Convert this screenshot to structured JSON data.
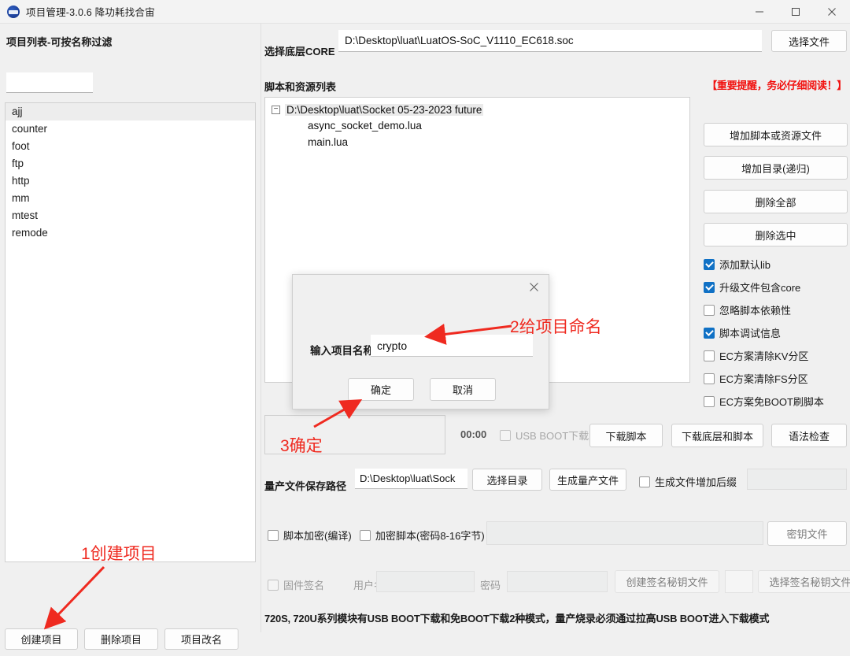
{
  "window": {
    "title": "项目管理-3.0.6 降功耗找合宙",
    "icon": "app-logo-icon",
    "controls": {
      "minimize": "minimize-icon",
      "maximize": "maximize-icon",
      "close": "close-icon"
    }
  },
  "left_panel": {
    "list_label": "项目列表-可按名称过滤",
    "filter_value": "",
    "filter_placeholder": "",
    "items": [
      {
        "label": "ajj",
        "selected": true
      },
      {
        "label": "counter",
        "selected": false
      },
      {
        "label": "foot",
        "selected": false
      },
      {
        "label": "ftp",
        "selected": false
      },
      {
        "label": "http",
        "selected": false
      },
      {
        "label": "mm",
        "selected": false
      },
      {
        "label": "mtest",
        "selected": false
      },
      {
        "label": "remode",
        "selected": false
      }
    ],
    "buttons": {
      "create": "创建项目",
      "delete": "删除项目",
      "rename": "项目改名"
    }
  },
  "main": {
    "core_label": "选择底层CORE",
    "core_path": "D:\\Desktop\\luat\\LuatOS-SoC_V1110_EC618.soc",
    "choose_file_button": "选择文件",
    "script_label": "脚本和资源列表",
    "warning": "【重要提醒，务必仔细阅读！】",
    "tree": {
      "toggle": "−",
      "root": "D:\\Desktop\\luat\\Socket 05-23-2023 future",
      "children": [
        "async_socket_demo.lua",
        "main.lua"
      ]
    },
    "right_buttons": [
      "增加脚本或资源文件",
      "增加目录(递归)",
      "删除全部",
      "删除选中"
    ],
    "checkboxes": [
      {
        "label": "添加默认lib",
        "checked": true
      },
      {
        "label": "升级文件包含core",
        "checked": true
      },
      {
        "label": "忽略脚本依赖性",
        "checked": false
      },
      {
        "label": "脚本调试信息",
        "checked": true
      },
      {
        "label": "EC方案清除KV分区",
        "checked": false
      },
      {
        "label": "EC方案清除FS分区",
        "checked": false
      },
      {
        "label": "EC方案免BOOT刷脚本",
        "checked": false
      }
    ],
    "download_row": {
      "timer": "00:00",
      "usb_boot_label": "USB BOOT下载",
      "usb_boot_checked": false,
      "download_script": "下载脚本",
      "download_core_and_script": "下载底层和脚本",
      "syntax_check": "语法检查"
    },
    "mass_production": {
      "label": "量产文件保存路径",
      "path": "D:\\Desktop\\luat\\Sock",
      "choose_dir": "选择目录",
      "generate": "生成量产文件",
      "suffix_label": "生成文件增加后缀",
      "suffix_checked": false,
      "suffix_value": ""
    },
    "encryption": {
      "compile_label": "脚本加密(编译)",
      "compile_checked": false,
      "encrypt_label": "加密脚本(密码8-16字节)",
      "encrypt_checked": false,
      "password_value": "",
      "key_file_button": "密钥文件"
    },
    "signature": {
      "label": "固件签名",
      "checked": false,
      "username_label": "用户名",
      "username_value": "",
      "password_label": "密码",
      "password_value": "",
      "create_key_button": "创建签名秘钥文件",
      "select_key_button": "选择签名秘钥文件"
    },
    "footer_note": "720S, 720U系列模块有USB BOOT下载和免BOOT下载2种模式，量产烧录必须通过拉高USB BOOT进入下载模式"
  },
  "dialog": {
    "close_icon": "close-icon",
    "input_label": "输入项目名称",
    "input_value": "crypto",
    "ok_button": "确定",
    "cancel_button": "取消"
  },
  "annotations": [
    {
      "id": "anno1",
      "text": "1创建项目"
    },
    {
      "id": "anno2",
      "text": "2给项目命名"
    },
    {
      "id": "anno3",
      "text": "3确定"
    }
  ],
  "colors": {
    "annotation_red": "#ef2a20",
    "warning_red": "#f1100e",
    "checkbox_blue": "#1071c5",
    "window_bg": "#f0f0f0"
  }
}
